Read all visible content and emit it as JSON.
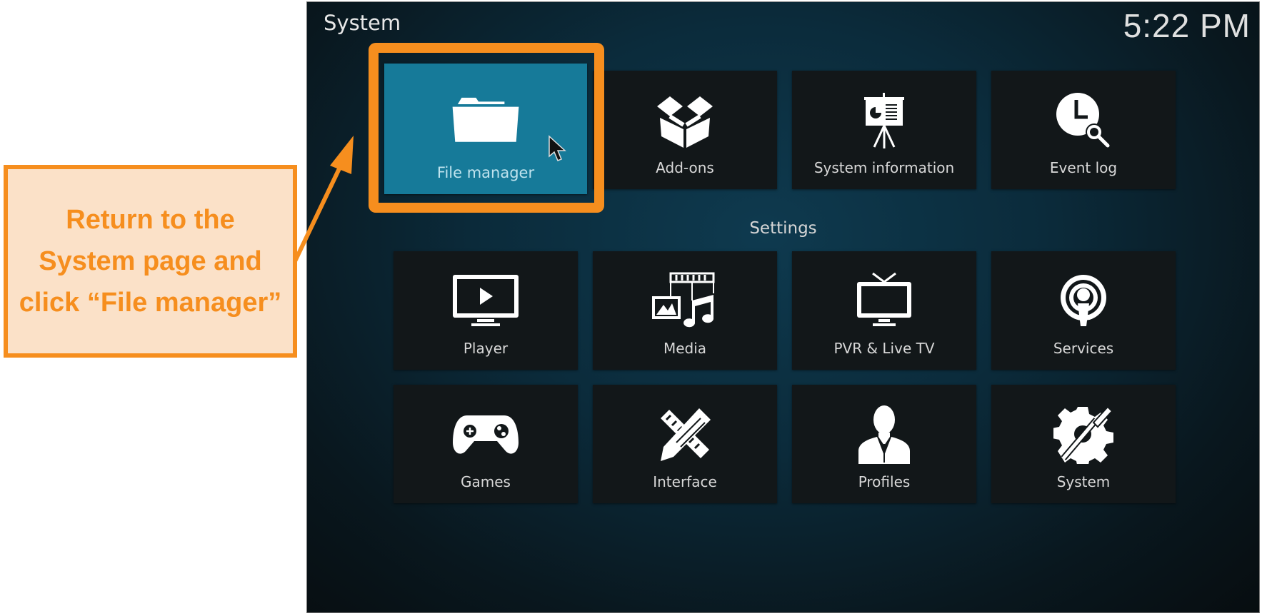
{
  "header": {
    "title": "System",
    "clock": "5:22 PM"
  },
  "top_tiles": [
    {
      "label": "File manager",
      "icon": "folder-icon",
      "selected": true
    },
    {
      "label": "Add-ons",
      "icon": "box-icon"
    },
    {
      "label": "System information",
      "icon": "presentation-icon"
    },
    {
      "label": "Event log",
      "icon": "clock-search-icon"
    }
  ],
  "settings": {
    "heading": "Settings",
    "tiles": [
      {
        "label": "Player",
        "icon": "monitor-play-icon"
      },
      {
        "label": "Media",
        "icon": "media-icon"
      },
      {
        "label": "PVR & Live TV",
        "icon": "tv-icon"
      },
      {
        "label": "Services",
        "icon": "podcast-icon"
      },
      {
        "label": "Games",
        "icon": "gamepad-icon"
      },
      {
        "label": "Interface",
        "icon": "pencil-ruler-icon"
      },
      {
        "label": "Profiles",
        "icon": "user-icon"
      },
      {
        "label": "System",
        "icon": "gear-screwdriver-icon"
      }
    ]
  },
  "annotation": {
    "text": "Return to the System page and click “File manager”",
    "color": "#f68e1e",
    "background": "#fbe1c8"
  },
  "colors": {
    "selected_tile": "#167a99",
    "tile": "#121719"
  }
}
